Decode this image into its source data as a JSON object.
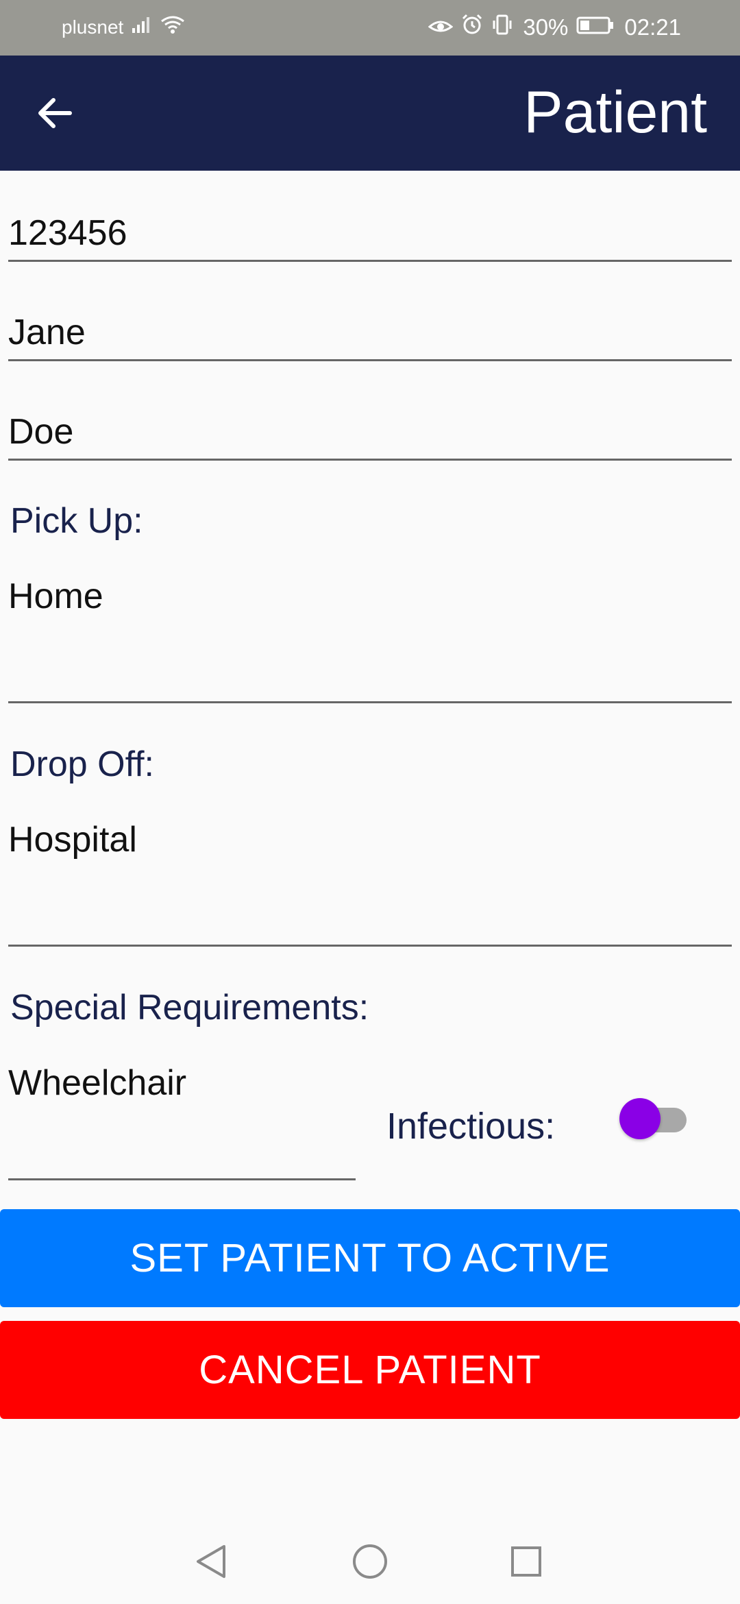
{
  "status_bar": {
    "carrier": "plusnet",
    "battery": "30%",
    "time": "02:21",
    "icons": [
      "signal-icon",
      "wifi-icon",
      "eye-comfort-icon",
      "alarm-icon",
      "vibrate-icon",
      "battery-icon"
    ]
  },
  "app_bar": {
    "title": "Patient",
    "back_icon": "arrow-left-icon"
  },
  "form": {
    "patient_id": "123456",
    "first_name": "Jane",
    "last_name": "Doe",
    "pickup_label": "Pick Up:",
    "pickup_value": "Home",
    "dropoff_label": "Drop Off:",
    "dropoff_value": "Hospital",
    "special_label": "Special Requirements:",
    "special_value": "Wheelchair",
    "infectious_label": "Infectious:",
    "infectious_on": false
  },
  "buttons": {
    "active_label": "SET PATIENT TO ACTIVE",
    "active_color": "#007aff",
    "cancel_label": "CANCEL PATIENT",
    "cancel_color": "#ff0000"
  },
  "colors": {
    "app_bar": "#19224c",
    "label": "#19224c",
    "toggle_thumb": "#8a00e6"
  },
  "nav_bar": {
    "icons": [
      "back-triangle-icon",
      "home-circle-icon",
      "recents-square-icon"
    ]
  }
}
